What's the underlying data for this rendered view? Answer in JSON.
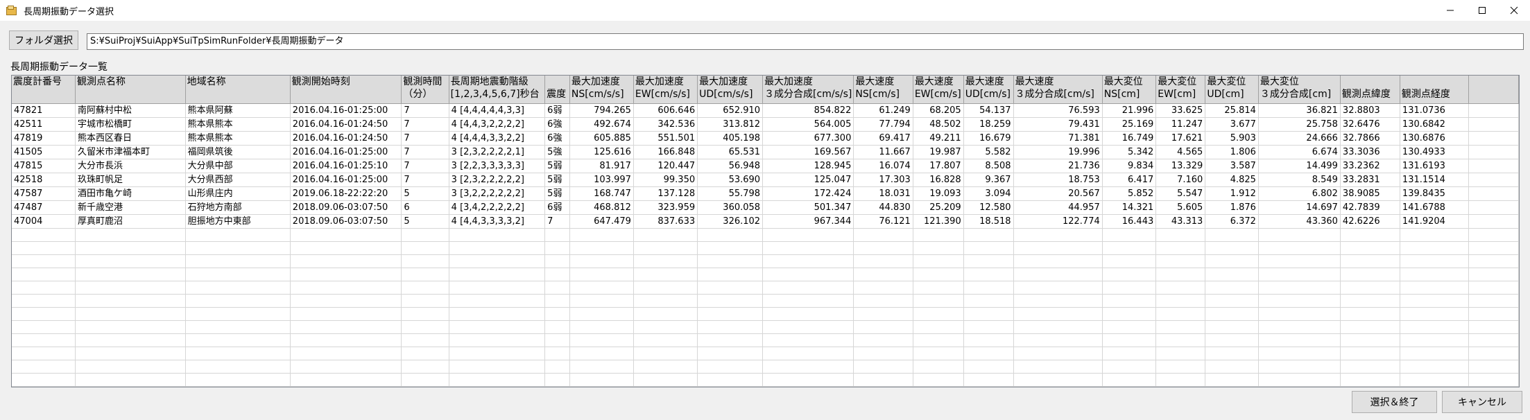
{
  "window": {
    "title": "長周期振動データ選択"
  },
  "folder": {
    "button_label": "フォルダ選択",
    "path": "S:¥SuiProj¥SuiApp¥SuiTpSimRunFolder¥長周期振動データ"
  },
  "list_label": "長周期振動データ一覧",
  "table": {
    "columns": [
      {
        "line1": "震度計番号",
        "line2": ""
      },
      {
        "line1": "観測点名称",
        "line2": ""
      },
      {
        "line1": "地域名称",
        "line2": ""
      },
      {
        "line1": "観測開始時刻",
        "line2": ""
      },
      {
        "line1": "観測時間",
        "line2": "（分）"
      },
      {
        "line1": "長周期地震動階級",
        "line2": "[1,2,3,4,5,6,7]秒台"
      },
      {
        "line1": "",
        "line2": "震度"
      },
      {
        "line1": "最大加速度",
        "line2": "NS[cm/s/s]"
      },
      {
        "line1": "最大加速度",
        "line2": "EW[cm/s/s]"
      },
      {
        "line1": "最大加速度",
        "line2": "UD[cm/s/s]"
      },
      {
        "line1": "最大加速度",
        "line2": "３成分合成[cm/s/s]"
      },
      {
        "line1": "最大速度",
        "line2": "NS[cm/s]"
      },
      {
        "line1": "最大速度",
        "line2": "EW[cm/s]"
      },
      {
        "line1": "最大速度",
        "line2": "UD[cm/s]"
      },
      {
        "line1": "最大速度",
        "line2": "３成分合成[cm/s]"
      },
      {
        "line1": "最大変位",
        "line2": "NS[cm]"
      },
      {
        "line1": "最大変位",
        "line2": "EW[cm]"
      },
      {
        "line1": "最大変位",
        "line2": "UD[cm]"
      },
      {
        "line1": "最大変位",
        "line2": "３成分合成[cm]"
      },
      {
        "line1": "",
        "line2": "観測点緯度"
      },
      {
        "line1": "",
        "line2": "観測点経度"
      },
      {
        "line1": "",
        "line2": ""
      }
    ],
    "rows": [
      [
        "47821",
        "南阿蘇村中松",
        "熊本県阿蘇",
        "2016.04.16-01:25:00",
        "7",
        "4 [4,4,4,4,4,3,3]",
        "6弱",
        "794.265",
        "606.646",
        "652.910",
        "854.822",
        "61.249",
        "68.205",
        "54.137",
        "76.593",
        "21.996",
        "33.625",
        "25.814",
        "36.821",
        "32.8803",
        "131.0736"
      ],
      [
        "42511",
        "宇城市松橋町",
        "熊本県熊本",
        "2016.04.16-01:24:50",
        "7",
        "4 [4,4,3,2,2,2,2]",
        "6強",
        "492.674",
        "342.536",
        "313.812",
        "564.005",
        "77.794",
        "48.502",
        "18.259",
        "79.431",
        "25.169",
        "11.247",
        "3.677",
        "25.758",
        "32.6476",
        "130.6842"
      ],
      [
        "47819",
        "熊本西区春日",
        "熊本県熊本",
        "2016.04.16-01:24:50",
        "7",
        "4 [4,4,4,3,3,2,2]",
        "6強",
        "605.885",
        "551.501",
        "405.198",
        "677.300",
        "69.417",
        "49.211",
        "16.679",
        "71.381",
        "16.749",
        "17.621",
        "5.903",
        "24.666",
        "32.7866",
        "130.6876"
      ],
      [
        "41505",
        "久留米市津福本町",
        "福岡県筑後",
        "2016.04.16-01:25:00",
        "7",
        "3 [2,3,2,2,2,2,1]",
        "5強",
        "125.616",
        "166.848",
        "65.531",
        "169.567",
        "11.667",
        "19.987",
        "5.582",
        "19.996",
        "5.342",
        "4.565",
        "1.806",
        "6.674",
        "33.3036",
        "130.4933"
      ],
      [
        "47815",
        "大分市長浜",
        "大分県中部",
        "2016.04.16-01:25:10",
        "7",
        "3 [2,2,3,3,3,3,3]",
        "5弱",
        "81.917",
        "120.447",
        "56.948",
        "128.945",
        "16.074",
        "17.807",
        "8.508",
        "21.736",
        "9.834",
        "13.329",
        "3.587",
        "14.499",
        "33.2362",
        "131.6193"
      ],
      [
        "42518",
        "玖珠町帆足",
        "大分県西部",
        "2016.04.16-01:25:00",
        "7",
        "3 [2,3,2,2,2,2,2]",
        "5弱",
        "103.997",
        "99.350",
        "53.690",
        "125.047",
        "17.303",
        "16.828",
        "9.367",
        "18.753",
        "6.417",
        "7.160",
        "4.825",
        "8.549",
        "33.2831",
        "131.1514"
      ],
      [
        "47587",
        "酒田市亀ケ崎",
        "山形県庄内",
        "2019.06.18-22:22:20",
        "5",
        "3 [3,2,2,2,2,2,2]",
        "5弱",
        "168.747",
        "137.128",
        "55.798",
        "172.424",
        "18.031",
        "19.093",
        "3.094",
        "20.567",
        "5.852",
        "5.547",
        "1.912",
        "6.802",
        "38.9085",
        "139.8435"
      ],
      [
        "47487",
        "新千歳空港",
        "石狩地方南部",
        "2018.09.06-03:07:50",
        "6",
        "4 [3,4,2,2,2,2,2]",
        "6弱",
        "468.812",
        "323.959",
        "360.058",
        "501.347",
        "44.830",
        "25.209",
        "12.580",
        "44.957",
        "14.321",
        "5.605",
        "1.876",
        "14.697",
        "42.7839",
        "141.6788"
      ],
      [
        "47004",
        "厚真町鹿沼",
        "胆振地方中東部",
        "2018.09.06-03:07:50",
        "5",
        "4 [4,4,3,3,3,3,2]",
        "7",
        "647.479",
        "837.633",
        "326.102",
        "967.344",
        "76.121",
        "121.390",
        "18.518",
        "122.774",
        "16.443",
        "43.313",
        "6.372",
        "43.360",
        "42.6226",
        "141.9204"
      ]
    ],
    "empty_rows": 15
  },
  "buttons": {
    "ok": "選択＆終了",
    "cancel": "キャンセル"
  }
}
